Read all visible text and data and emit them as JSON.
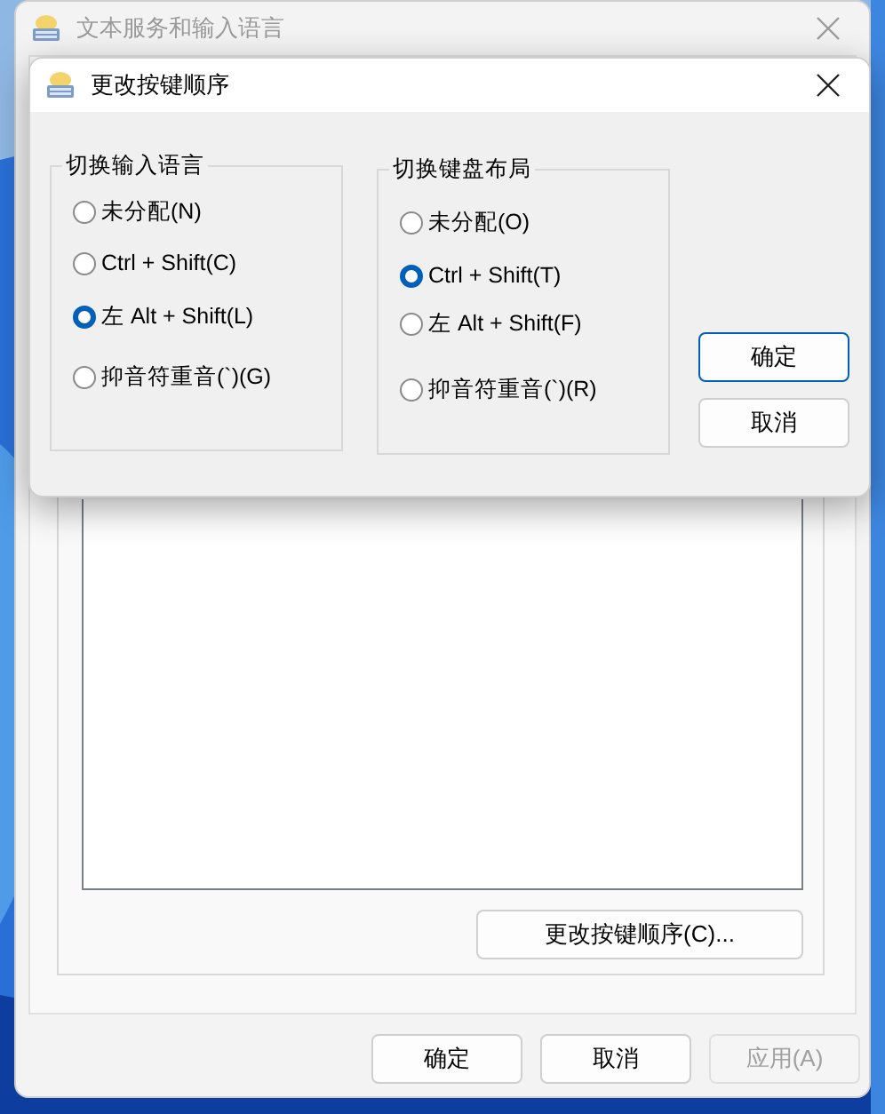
{
  "main_window": {
    "title": "文本服务和输入语言",
    "change_sequence_button": "更改按键顺序(C)...",
    "buttons": [
      {
        "label": "确定",
        "disabled": false
      },
      {
        "label": "取消",
        "disabled": false
      },
      {
        "label": "应用(A)",
        "disabled": true
      }
    ]
  },
  "dialog": {
    "title": "更改按键顺序",
    "groups": [
      {
        "title": "切换输入语言",
        "options": [
          {
            "label": "未分配(N)",
            "selected": false
          },
          {
            "label": "Ctrl + Shift(C)",
            "selected": false
          },
          {
            "label": "左 Alt + Shift(L)",
            "selected": true
          },
          {
            "label": "抑音符重音(`)(G)",
            "selected": false
          }
        ]
      },
      {
        "title": "切换键盘布局",
        "options": [
          {
            "label": "未分配(O)",
            "selected": false
          },
          {
            "label": "Ctrl + Shift(T)",
            "selected": true
          },
          {
            "label": "左 Alt + Shift(F)",
            "selected": false
          },
          {
            "label": "抑音符重音(`)(R)",
            "selected": false
          }
        ]
      }
    ],
    "buttons": [
      {
        "label": "确定",
        "default": true
      },
      {
        "label": "取消",
        "default": false
      }
    ]
  }
}
